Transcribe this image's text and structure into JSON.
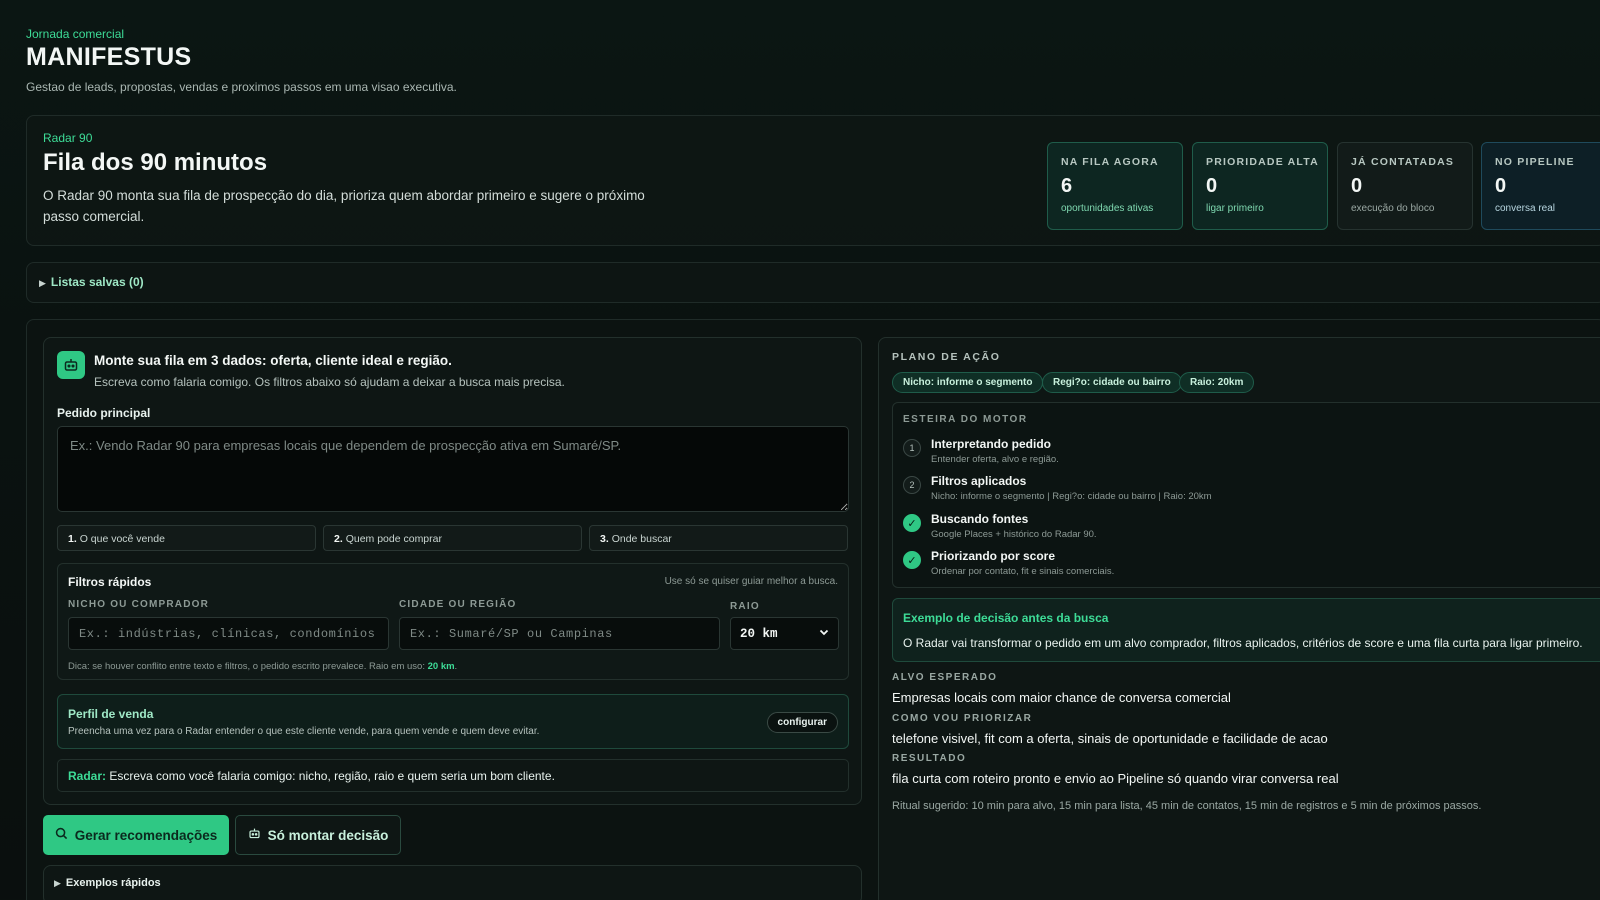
{
  "header": {
    "eyebrow": "Jornada comercial",
    "title": "MANIFESTUS",
    "subtitle": "Gestao de leads, propostas, vendas e proximos passos em uma visao executiva."
  },
  "radar": {
    "eyebrow": "Radar 90",
    "title": "Fila dos 90 minutos",
    "description": "O Radar 90 monta sua fila de prospecção do dia, prioriza quem abordar primeiro e sugere o próximo passo comercial."
  },
  "stats": [
    {
      "label": "NA FILA AGORA",
      "value": "6",
      "sub": "oportunidades ativas"
    },
    {
      "label": "PRIORIDADE ALTA",
      "value": "0",
      "sub": "ligar primeiro"
    },
    {
      "label": "JÁ CONTATADAS",
      "value": "0",
      "sub": "execução do bloco"
    },
    {
      "label": "NO PIPELINE",
      "value": "0",
      "sub": "conversa real"
    }
  ],
  "saved_lists": {
    "label": "Listas salvas (0)"
  },
  "builder": {
    "title": "Monte sua fila em 3 dados: oferta, cliente ideal e região.",
    "subtitle": "Escreva como falaria comigo. Os filtros abaixo só ajudam a deixar a busca mais precisa.",
    "main_request_label": "Pedido principal",
    "main_request_placeholder": "Ex.: Vendo Radar 90 para empresas locais que dependem de prospecção ativa em Sumaré/SP.",
    "steps": [
      {
        "num": "1.",
        "label": "O que você vende"
      },
      {
        "num": "2.",
        "label": "Quem pode comprar"
      },
      {
        "num": "3.",
        "label": "Onde buscar"
      }
    ],
    "quick_filters": {
      "title": "Filtros rápidos",
      "hint": "Use só se quiser guiar melhor a busca.",
      "niche_label": "NICHO OU COMPRADOR",
      "niche_placeholder": "Ex.: indústrias, clínicas, condomínios",
      "city_label": "CIDADE OU REGIÃO",
      "city_placeholder": "Ex.: Sumaré/SP ou Campinas",
      "radius_label": "RAIO",
      "radius_value": "20 km",
      "tip_prefix": "Dica: se houver conflito entre texto e filtros, o pedido escrito prevalece. Raio em uso:",
      "tip_value": "20 km",
      "tip_suffix": "."
    },
    "sales_profile": {
      "title": "Perfil de venda",
      "description": "Preencha uma vez para o Radar entender o que este cliente vende, para quem vende e quem deve evitar.",
      "button": "configurar"
    },
    "radar_note": {
      "prefix": "Radar:",
      "text": "Escreva como você falaria comigo: nicho, região, raio e quem seria um bom cliente."
    },
    "primary_button": "Gerar recomendações",
    "secondary_button": "Só montar decisão",
    "examples_label": "Exemplos rápidos"
  },
  "action_plan": {
    "heading": "PLANO DE AÇÃO",
    "chips": [
      "Nicho: informe o segmento",
      "Regi?o: cidade ou bairro",
      "Raio: 20km"
    ],
    "engine": {
      "heading": "ESTEIRA DO MOTOR",
      "steps": [
        {
          "marker": "1",
          "title": "Interpretando pedido",
          "desc": "Entender oferta, alvo e região."
        },
        {
          "marker": "2",
          "title": "Filtros aplicados",
          "desc": "Nicho: informe o segmento | Regi?o: cidade ou bairro | Raio: 20km"
        },
        {
          "marker": "✓",
          "title": "Buscando fontes",
          "desc": "Google Places + histórico do Radar 90."
        },
        {
          "marker": "✓",
          "title": "Priorizando por score",
          "desc": "Ordenar por contato, fit e sinais comerciais."
        }
      ]
    },
    "example": {
      "title": "Exemplo de decisão antes da busca",
      "text": "O Radar vai transformar o pedido em um alvo comprador, filtros aplicados, critérios de score e uma fila curta para ligar primeiro."
    },
    "expected_label": "ALVO ESPERADO",
    "expected_value": "Empresas locais com maior chance de conversa comercial",
    "prioritize_label": "COMO VOU PRIORIZAR",
    "prioritize_value": "telefone visivel, fit com a oferta, sinais de oportunidade e facilidade de acao",
    "result_label": "RESULTADO",
    "result_value": "fila curta com roteiro pronto e envio ao Pipeline só quando virar conversa real",
    "ritual": "Ritual sugerido: 10 min para alvo, 15 min para lista, 45 min de contatos, 15 min de registros e 5 min de próximos passos."
  },
  "colors": {
    "accent": "#2fc884",
    "accent_text": "#3ddc97",
    "background": "#0a1210"
  }
}
